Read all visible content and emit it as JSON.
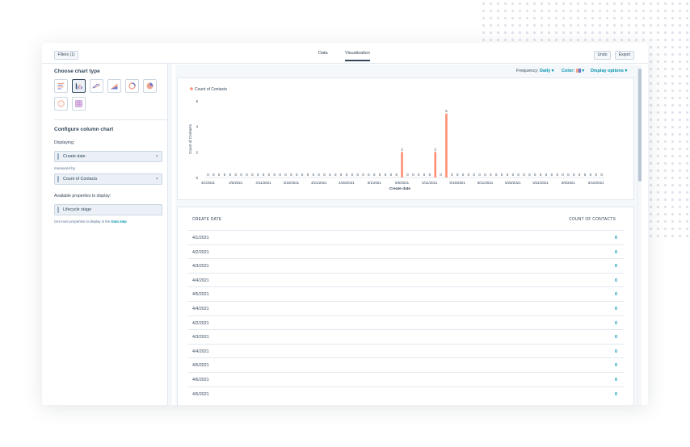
{
  "toolbar": {
    "filters_label": "Filters (1)",
    "tabs": [
      "Data",
      "Visualization"
    ],
    "undo_label": "Undo",
    "export_label": "Export"
  },
  "left_panel": {
    "choose_heading": "Choose chart type",
    "chart_types": [
      "bar-horizontal-icon",
      "column-chart-icon",
      "line-chart-icon",
      "area-chart-icon",
      "donut-chart-icon",
      "pie-chart-icon",
      "number-badge-icon",
      "pivot-table-icon"
    ],
    "configure_heading": "Configure column chart",
    "displaying_label": "Displaying:",
    "displaying_value": "Create date",
    "measured_by_label": "measured by",
    "measure_value": "Count of Contacts",
    "available_label": "Available properties to display:",
    "available_item": "Lifecycle stage",
    "hint_text": "Get more properties to display in the ",
    "hint_link": "Data step"
  },
  "chart_options": {
    "frequency_label": "Frequency:",
    "frequency_value": "Daily",
    "color_label": "Color:",
    "display_options_label": "Display options"
  },
  "chart_data": {
    "type": "bar",
    "legend": "Count of Contacts",
    "ylabel": "Count of Contacts",
    "xlabel": "Create date",
    "ylim": [
      0,
      6
    ],
    "yticks": [
      "6",
      "4",
      "2",
      "0"
    ],
    "xticks": [
      "4/1/2021",
      "4/6/2021",
      "4/11/2021",
      "4/16/2021",
      "4/21/2021",
      "4/26/2021",
      "5/1/2021",
      "5/6/2021",
      "5/11/2021",
      "5/16/2021",
      "5/21/2021",
      "5/26/2021",
      "5/31/2021",
      "6/5/2021",
      "6/10/2021"
    ],
    "values": [
      0,
      0,
      0,
      0,
      0,
      0,
      0,
      0,
      0,
      0,
      0,
      0,
      0,
      0,
      0,
      0,
      0,
      0,
      0,
      0,
      0,
      0,
      0,
      0,
      0,
      0,
      0,
      0,
      0,
      0,
      0,
      0,
      0,
      0,
      0,
      2,
      0,
      0,
      0,
      0,
      0,
      2,
      0,
      5,
      0,
      0,
      0,
      0,
      0,
      0,
      0,
      0,
      0,
      0,
      0,
      0,
      0,
      0,
      0,
      0,
      0,
      0,
      0,
      0,
      0,
      0,
      0,
      0,
      0,
      0,
      0,
      0
    ],
    "bar_color": "#ff8f73"
  },
  "table": {
    "col_date": "CREATE DATE",
    "col_count": "COUNT OF CONTACTS",
    "rows": [
      {
        "date": "4/1/2021",
        "count": "0"
      },
      {
        "date": "4/2/2021",
        "count": "0"
      },
      {
        "date": "4/3/2021",
        "count": "0"
      },
      {
        "date": "4/4/2021",
        "count": "0"
      },
      {
        "date": "4/5/2021",
        "count": "0"
      },
      {
        "date": "4/4/2021",
        "count": "0"
      },
      {
        "date": "4/2/2021",
        "count": "0"
      },
      {
        "date": "4/3/2021",
        "count": "0"
      },
      {
        "date": "4/4/2021",
        "count": "0"
      },
      {
        "date": "4/5/2021",
        "count": "0"
      },
      {
        "date": "4/6/2021",
        "count": "0"
      },
      {
        "date": "4/5/2021",
        "count": "0"
      }
    ]
  },
  "colors": {
    "accent": "#0091ae",
    "brand_orange": "#ff7a59",
    "text": "#33475b"
  }
}
